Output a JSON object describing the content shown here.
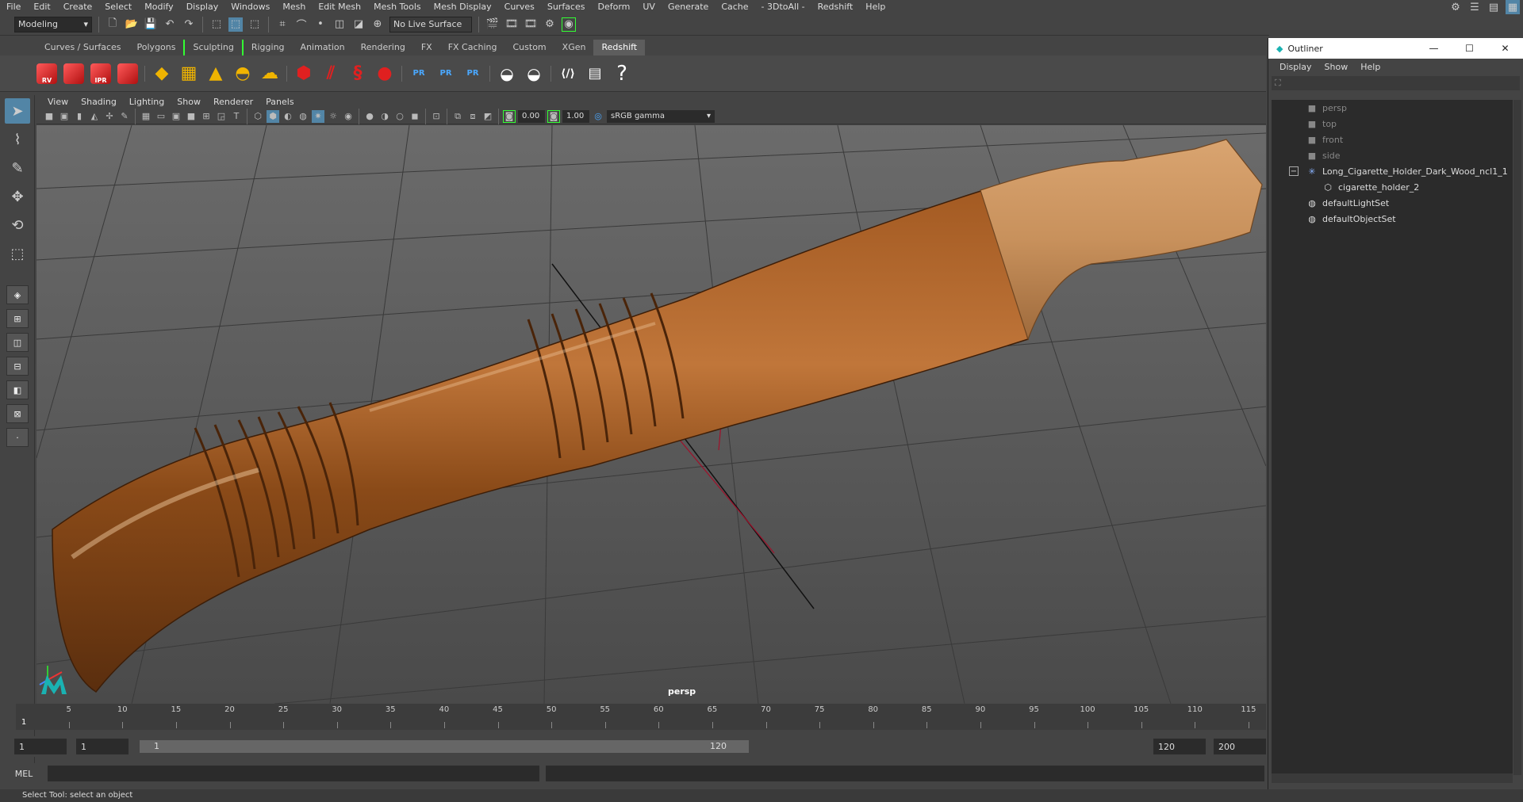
{
  "menubar": {
    "items": [
      "File",
      "Edit",
      "Create",
      "Select",
      "Modify",
      "Display",
      "Windows",
      "Mesh",
      "Edit Mesh",
      "Mesh Tools",
      "Mesh Display",
      "Curves",
      "Surfaces",
      "Deform",
      "UV",
      "Generate",
      "Cache",
      "- 3DtoAll -",
      "Redshift",
      "Help"
    ]
  },
  "statusline": {
    "mode": "Modeling",
    "live_surface": "No Live Surface"
  },
  "shelf": {
    "tabs": [
      "Curves / Surfaces",
      "Polygons",
      "Sculpting",
      "Rigging",
      "Animation",
      "Rendering",
      "FX",
      "FX Caching",
      "Custom",
      "XGen",
      "Redshift"
    ],
    "active_tab": "Redshift",
    "rs_labels": [
      "RV",
      "",
      "IPR",
      ""
    ],
    "pr_labels": [
      "PR",
      "PR",
      "PR"
    ],
    "help_glyph": "?"
  },
  "viewport": {
    "menu": [
      "View",
      "Shading",
      "Lighting",
      "Show",
      "Renderer",
      "Panels"
    ],
    "exposure": "0.00",
    "gamma": "1.00",
    "color_space": "sRGB gamma",
    "camera": "persp"
  },
  "timeline": {
    "ticks": [
      "5",
      "10",
      "15",
      "20",
      "25",
      "30",
      "35",
      "40",
      "45",
      "50",
      "55",
      "60",
      "65",
      "70",
      "75",
      "80",
      "85",
      "90",
      "95",
      "100",
      "105",
      "110",
      "115"
    ],
    "current_frame": "1"
  },
  "range": {
    "start": "1",
    "playback_start": "1",
    "slider_start": "1",
    "slider_end": "120",
    "playback_end": "120",
    "end": "200"
  },
  "cmdline": {
    "label": "MEL"
  },
  "helpline": {
    "text": "Select Tool: select an object"
  },
  "outliner": {
    "title": "Outliner",
    "menu": [
      "Display",
      "Show",
      "Help"
    ],
    "items": [
      {
        "label": "persp",
        "dim": true
      },
      {
        "label": "top",
        "dim": true
      },
      {
        "label": "front",
        "dim": true
      },
      {
        "label": "side",
        "dim": true
      },
      {
        "label": "Long_Cigarette_Holder_Dark_Wood_ncl1_1",
        "dim": false
      },
      {
        "label": "cigarette_holder_2",
        "dim": false
      },
      {
        "label": "defaultLightSet",
        "dim": false
      },
      {
        "label": "defaultObjectSet",
        "dim": false
      }
    ]
  },
  "colors": {
    "accent": "#5285a6",
    "wood_dark": "#8a4a18",
    "wood_light": "#c8915c"
  }
}
